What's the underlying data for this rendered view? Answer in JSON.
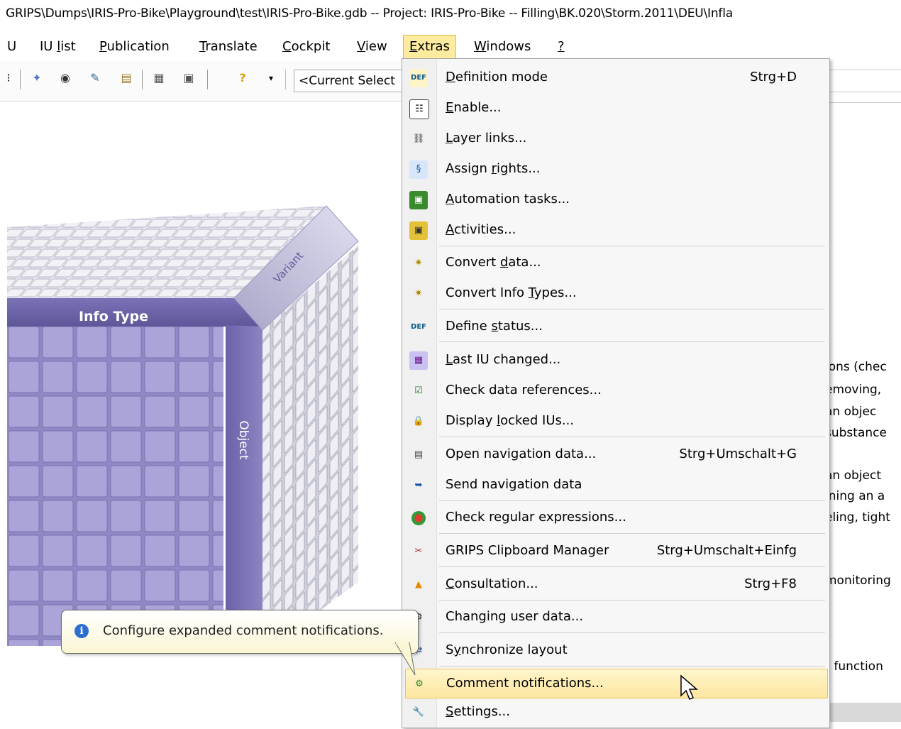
{
  "window": {
    "title": "GRIPS\\Dumps\\IRIS-Pro-Bike\\Playground\\test\\IRIS-Pro-Bike.gdb -- Project: IRIS-Pro-Bike -- Filling\\BK.020\\Storm.2011\\DEU\\Infla"
  },
  "menubar": [
    {
      "label": "U",
      "underline": ""
    },
    {
      "label": "IU list",
      "pre": "IU ",
      "u": "l",
      "post": "ist"
    },
    {
      "label": "Publication",
      "pre": "",
      "u": "P",
      "post": "ublication"
    },
    {
      "label": "Translate",
      "pre": "",
      "u": "T",
      "post": "ranslate"
    },
    {
      "label": "Cockpit",
      "pre": "",
      "u": "C",
      "post": "ockpit"
    },
    {
      "label": "View",
      "pre": "",
      "u": "V",
      "post": "iew"
    },
    {
      "label": "Extras",
      "pre": "",
      "u": "E",
      "post": "xtras"
    },
    {
      "label": "Windows",
      "pre": "",
      "u": "W",
      "post": "indows"
    },
    {
      "label": "?",
      "pre": "",
      "u": "?",
      "post": ""
    }
  ],
  "toolbar": {
    "selection_combo": "<Current Select"
  },
  "cube": {
    "top_label": "Info Type",
    "side_label": "Object",
    "corner_label": "Variant"
  },
  "extras_menu": [
    {
      "pre": "",
      "u": "D",
      "post": "efinition mode",
      "shortcut": "Strg+D",
      "icon": "definition-mode-icon"
    },
    {
      "pre": "",
      "u": "E",
      "post": "nable...",
      "shortcut": "",
      "icon": "enable-icon"
    },
    {
      "pre": "",
      "u": "L",
      "post": "ayer links...",
      "shortcut": "",
      "icon": "layer-links-icon"
    },
    {
      "pre": "Assign ",
      "u": "r",
      "post": "ights...",
      "shortcut": "",
      "icon": "assign-rights-icon"
    },
    {
      "pre": "",
      "u": "A",
      "post": "utomation tasks...",
      "shortcut": "",
      "icon": "automation-tasks-icon"
    },
    {
      "pre": "",
      "u": "A",
      "post": "ctivities...",
      "shortcut": "",
      "icon": "activities-icon"
    },
    {
      "pre": "Convert ",
      "u": "d",
      "post": "ata...",
      "shortcut": "",
      "icon": "convert-data-icon"
    },
    {
      "pre": "Convert Info ",
      "u": "T",
      "post": "ypes...",
      "shortcut": "",
      "icon": "convert-info-types-icon"
    },
    {
      "pre": "Define ",
      "u": "s",
      "post": "tatus...",
      "shortcut": "",
      "icon": "define-status-icon"
    },
    {
      "pre": "",
      "u": "L",
      "post": "ast IU changed...",
      "shortcut": "",
      "icon": "last-iu-changed-icon"
    },
    {
      "pre": "Check data references...",
      "u": "",
      "post": "",
      "shortcut": "",
      "icon": "check-data-references-icon"
    },
    {
      "pre": "Display ",
      "u": "l",
      "post": "ocked IUs...",
      "shortcut": "",
      "icon": "display-locked-ius-icon"
    },
    {
      "pre": "Open navigation data...",
      "u": "",
      "post": "",
      "shortcut": "Strg+Umschalt+G",
      "icon": "open-navigation-data-icon"
    },
    {
      "pre": "Send navigation data",
      "u": "",
      "post": "",
      "shortcut": "",
      "icon": "send-navigation-data-icon"
    },
    {
      "pre": "Check regular expressions...",
      "u": "",
      "post": "",
      "shortcut": "",
      "icon": "check-regex-icon"
    },
    {
      "pre": "GRIPS Clipboard Manager",
      "u": "",
      "post": "",
      "shortcut": "Strg+Umschalt+Einfg",
      "icon": "clipboard-manager-icon"
    },
    {
      "pre": "",
      "u": "C",
      "post": "onsultation...",
      "shortcut": "Strg+F8",
      "icon": "consultation-icon"
    },
    {
      "pre": "Changing user data...",
      "u": "",
      "post": "",
      "shortcut": "",
      "icon": "changing-user-data-icon"
    },
    {
      "pre": "S",
      "u": "y",
      "post": "nchronize layout",
      "shortcut": "",
      "icon": "synchronize-layout-icon"
    },
    {
      "pre": "Comment notifications...",
      "u": "",
      "post": "",
      "shortcut": "",
      "icon": "comment-notifications-icon",
      "highlighted": true
    },
    {
      "pre": "",
      "u": "S",
      "post": "ettings...",
      "shortcut": "",
      "icon": "settings-icon"
    }
  ],
  "tooltip": {
    "text": "Configure expanded comment notifications."
  },
  "background_text": [
    "ions (chec",
    "emoving,",
    "an objec",
    "substance",
    "an object",
    "ining an a",
    "eling, tight",
    "monitoring",
    "r function"
  ],
  "colors": {
    "menu_highlight": "#fdeca0",
    "cube_face": "#a9a3d6",
    "tooltip_bg": "#fbf6d4"
  }
}
